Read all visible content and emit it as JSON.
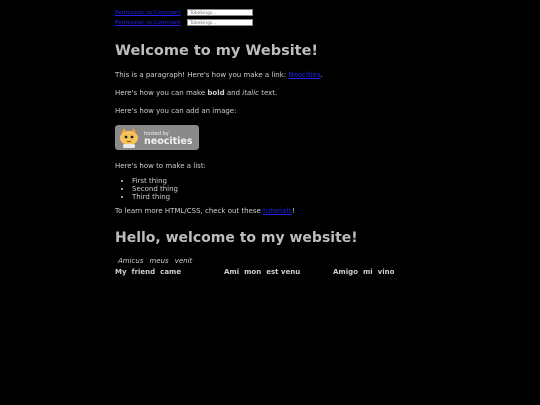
{
  "top_links": [
    {
      "label": "Permission to Comment",
      "field_placeholder": "Tobekings..."
    },
    {
      "label": "Permission to Comment",
      "field_placeholder": "Tobekings..."
    }
  ],
  "heading1": "Welcome to my Website!",
  "paragraphs": {
    "p1_prefix": "This is a paragraph! Here's how you make a link: ",
    "p1_link": "Neocities",
    "p1_suffix": ".",
    "p2_prefix": "Here's how you can make ",
    "p2_bold": "bold",
    "p2_mid": " and ",
    "p2_italic": "italic",
    "p2_suffix": " text.",
    "p3": "Here's how you can add an image:"
  },
  "badge": {
    "small": "hosted by",
    "big": "neocities"
  },
  "list_intro": "Here's how to make a list:",
  "list_items": [
    "First thing",
    "Second thing",
    "Third thing"
  ],
  "learn_more": {
    "prefix": "To learn more HTML/CSS, check out these ",
    "link": "tutorials",
    "suffix": "!"
  },
  "heading2": "Hello, welcome to my website!",
  "table": {
    "caption_row": [
      "Amicus",
      "meus",
      "venit"
    ],
    "header_groups": [
      [
        "My",
        "friend",
        "came"
      ],
      [
        "Ami",
        "mon",
        "est venu"
      ],
      [
        "Amigo",
        "mi",
        "vino"
      ]
    ]
  },
  "colors": {
    "background": "#000000",
    "text": "#cfcfcf",
    "link": "#2222ee"
  }
}
